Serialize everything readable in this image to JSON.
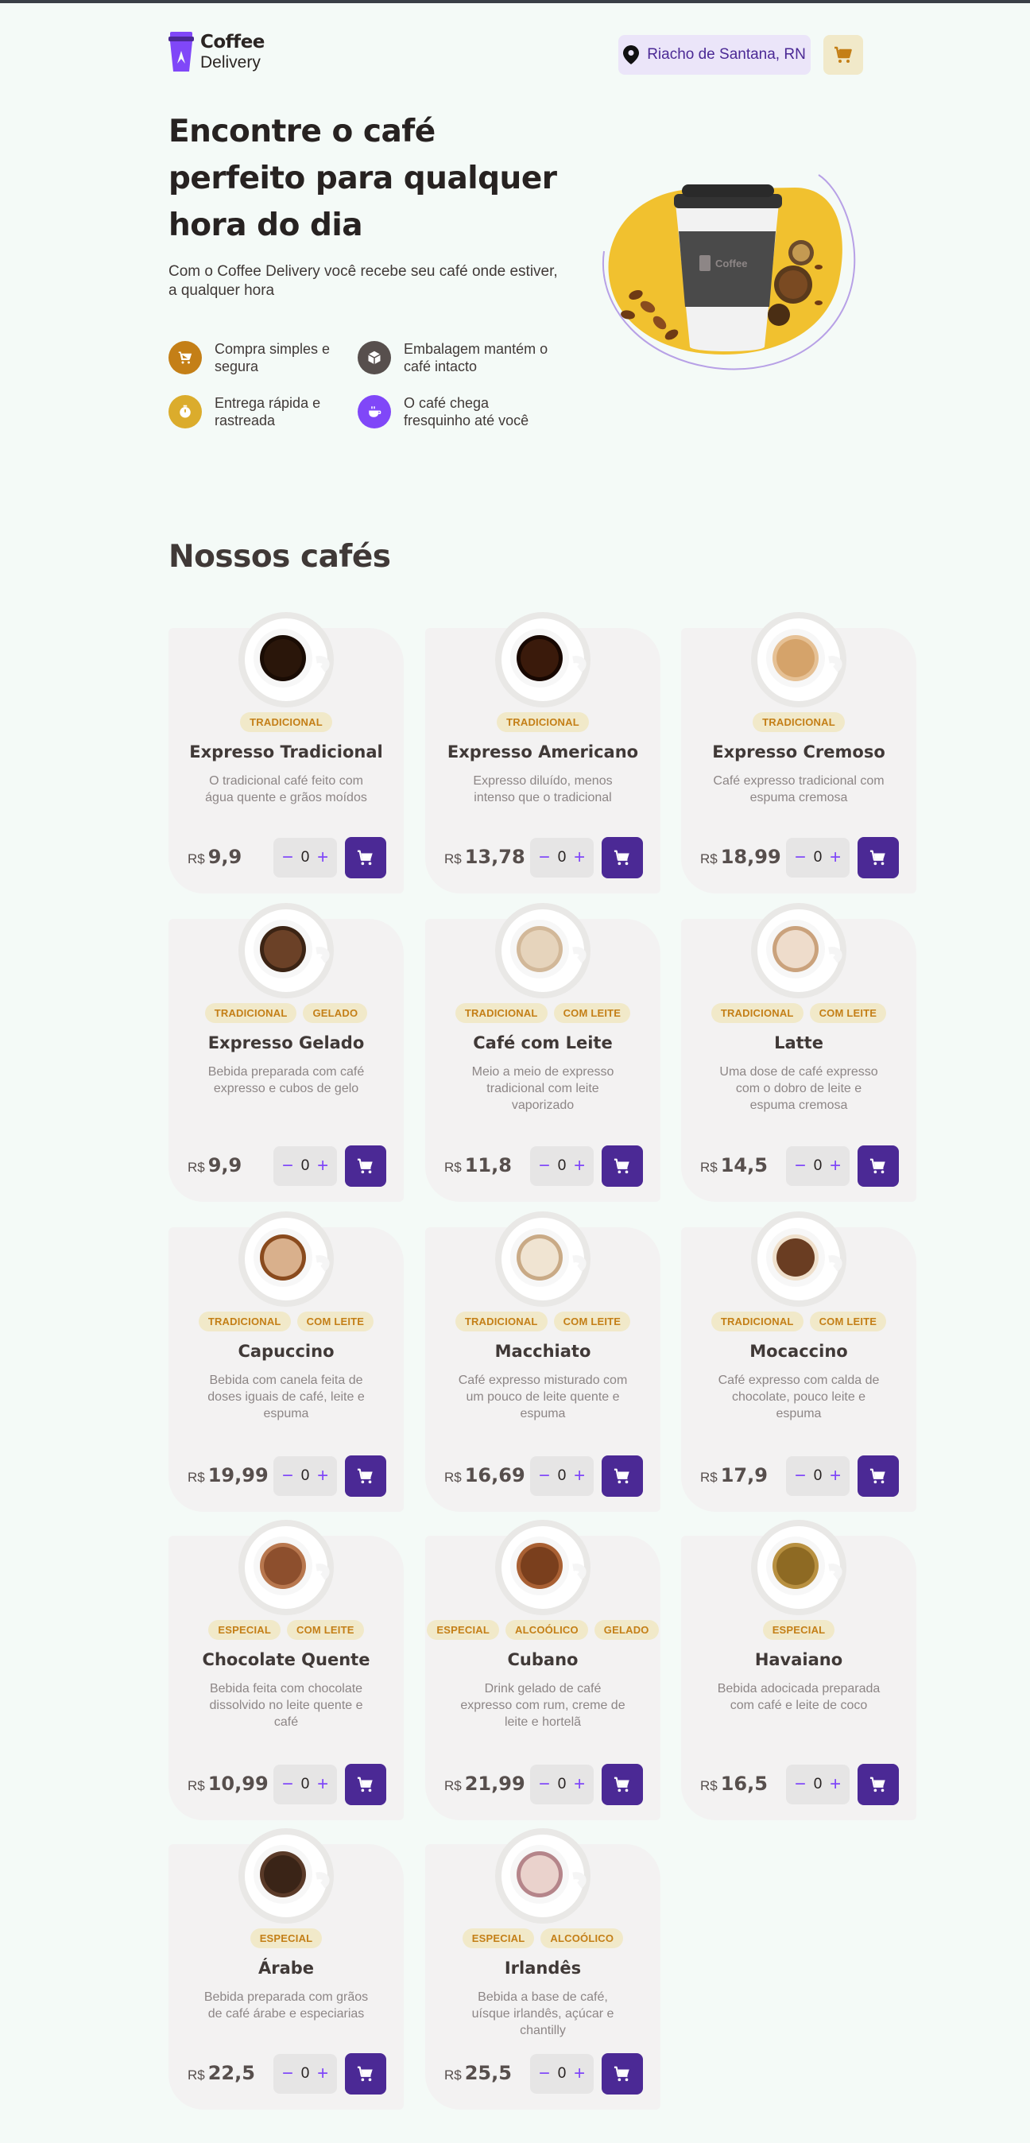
{
  "header": {
    "logo_line1": "Coffee",
    "logo_line2": "Delivery",
    "location": "Riacho de Santana, RN"
  },
  "hero": {
    "title": "Encontre o café perfeito para qualquer hora do dia",
    "subtitle": "Com o Coffee Delivery você recebe seu café onde estiver, a qualquer hora",
    "features": [
      {
        "text": "Compra simples e segura",
        "icon": "cart-icon",
        "color": "#c47f17"
      },
      {
        "text": "Embalagem mantém o café intacto",
        "icon": "package-icon",
        "color": "#574f4d"
      },
      {
        "text": "Entrega rápida e rastreada",
        "icon": "timer-icon",
        "color": "#dbac2c"
      },
      {
        "text": "O café chega fresquinho até você",
        "icon": "coffee-icon",
        "color": "#8047f8"
      }
    ]
  },
  "section_title": "Nossos cafés",
  "currency": "R$",
  "colors": {
    "purple_dark": "#4b2995",
    "purple": "#8047f8",
    "yellow": "#dbac2c",
    "yellow_dark": "#c47f17",
    "card": "#f3f2f2"
  },
  "products": [
    {
      "name": "Expresso Tradicional",
      "desc": "O tradicional café feito com água quente e grãos moídos",
      "tags": [
        "TRADICIONAL"
      ],
      "price": "9,9",
      "qty": "0"
    },
    {
      "name": "Expresso Americano",
      "desc": "Expresso diluído, menos intenso que o tradicional",
      "tags": [
        "TRADICIONAL"
      ],
      "price": "13,78",
      "qty": "0"
    },
    {
      "name": "Expresso Cremoso",
      "desc": "Café expresso tradicional com espuma cremosa",
      "tags": [
        "TRADICIONAL"
      ],
      "price": "18,99",
      "qty": "0"
    },
    {
      "name": "Expresso Gelado",
      "desc": "Bebida preparada com café expresso e cubos de gelo",
      "tags": [
        "TRADICIONAL",
        "GELADO"
      ],
      "price": "9,9",
      "qty": "0"
    },
    {
      "name": "Café com Leite",
      "desc": "Meio a meio de expresso tradicional com leite vaporizado",
      "tags": [
        "TRADICIONAL",
        "COM LEITE"
      ],
      "price": "11,8",
      "qty": "0"
    },
    {
      "name": "Latte",
      "desc": "Uma dose de café expresso com o dobro de leite e espuma cremosa",
      "tags": [
        "TRADICIONAL",
        "COM LEITE"
      ],
      "price": "14,5",
      "qty": "0"
    },
    {
      "name": "Capuccino",
      "desc": "Bebida com canela feita de doses iguais de café, leite e espuma",
      "tags": [
        "TRADICIONAL",
        "COM LEITE"
      ],
      "price": "19,99",
      "qty": "0"
    },
    {
      "name": "Macchiato",
      "desc": "Café expresso misturado com um pouco de leite quente e espuma",
      "tags": [
        "TRADICIONAL",
        "COM LEITE"
      ],
      "price": "16,69",
      "qty": "0"
    },
    {
      "name": "Mocaccino",
      "desc": "Café expresso com calda de chocolate, pouco leite e espuma",
      "tags": [
        "TRADICIONAL",
        "COM LEITE"
      ],
      "price": "17,9",
      "qty": "0"
    },
    {
      "name": "Chocolate Quente",
      "desc": "Bebida feita com chocolate dissolvido no leite quente e café",
      "tags": [
        "ESPECIAL",
        "COM LEITE"
      ],
      "price": "10,99",
      "qty": "0"
    },
    {
      "name": "Cubano",
      "desc": "Drink gelado de café expresso com rum, creme de leite e hortelã",
      "tags": [
        "ESPECIAL",
        "ALCOÓLICO",
        "GELADO"
      ],
      "price": "21,99",
      "qty": "0"
    },
    {
      "name": "Havaiano",
      "desc": "Bebida adocicada preparada com café e leite de coco",
      "tags": [
        "ESPECIAL"
      ],
      "price": "16,5",
      "qty": "0"
    },
    {
      "name": "Árabe",
      "desc": "Bebida preparada com grãos de café árabe e especiarias",
      "tags": [
        "ESPECIAL"
      ],
      "price": "22,5",
      "qty": "0"
    },
    {
      "name": "Irlandês",
      "desc": "Bebida a base de café, uísque irlandês, açúcar e chantilly",
      "tags": [
        "ESPECIAL",
        "ALCOÓLICO"
      ],
      "price": "25,5",
      "qty": "0"
    }
  ]
}
